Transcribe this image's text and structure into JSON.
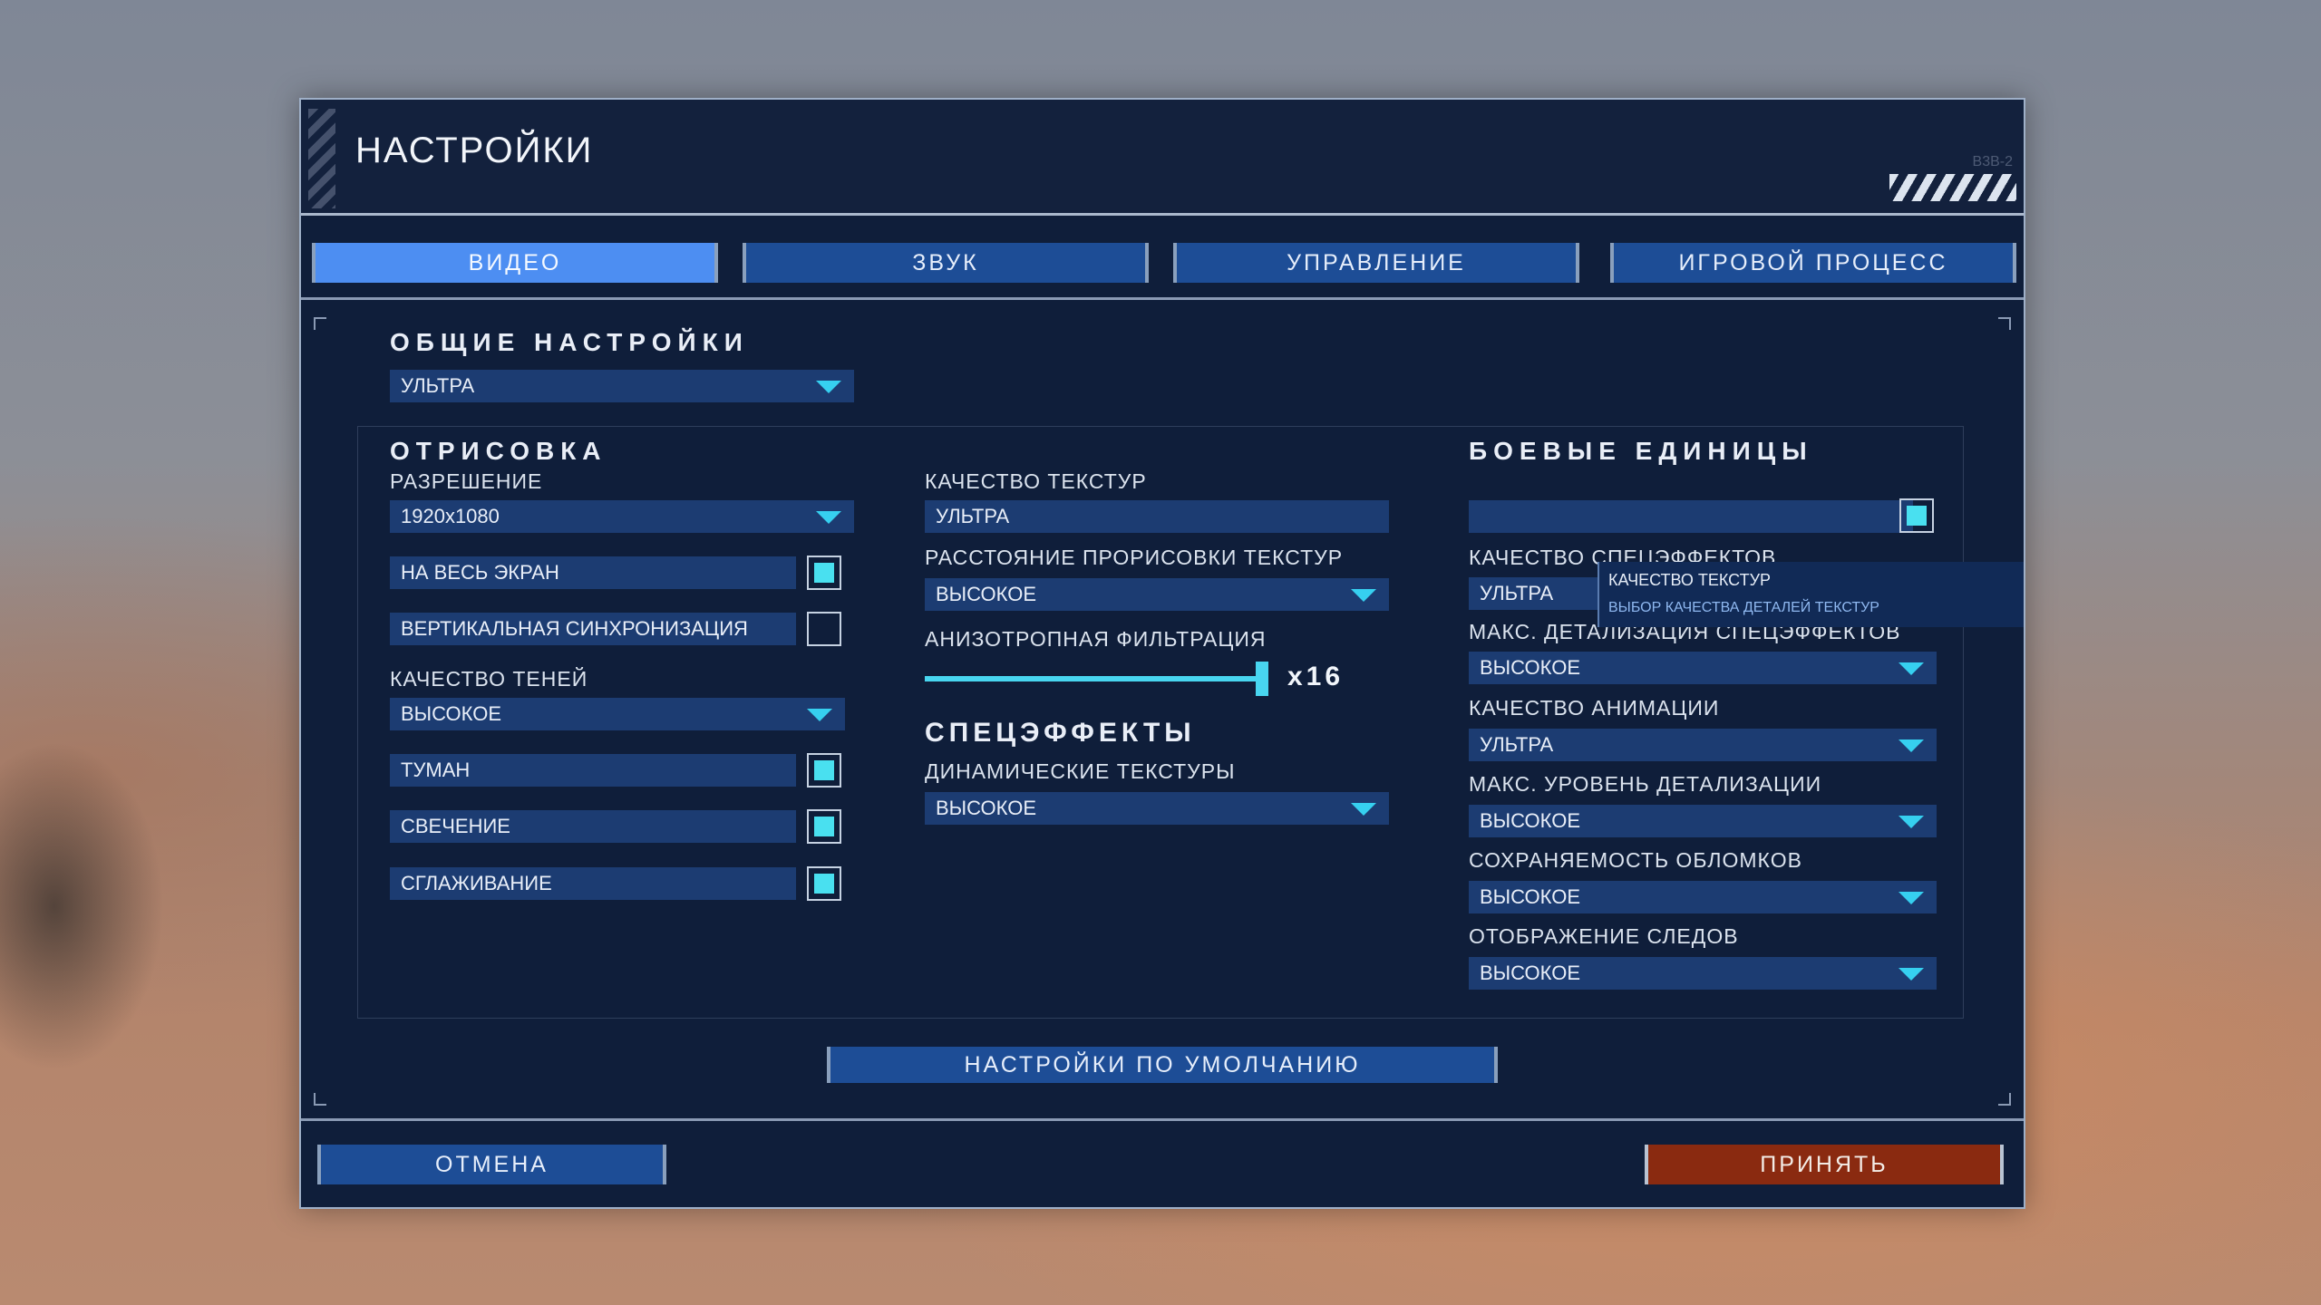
{
  "window": {
    "title": "НАСТРОЙКИ",
    "header_code": "B3B-2"
  },
  "tabs": [
    {
      "label": "ВИДЕО",
      "active": true
    },
    {
      "label": "ЗВУК",
      "active": false
    },
    {
      "label": "УПРАВЛЕНИЕ",
      "active": false
    },
    {
      "label": "ИГРОВОЙ ПРОЦЕСС",
      "active": false
    }
  ],
  "general": {
    "title": "ОБЩИЕ НАСТРОЙКИ",
    "preset": "УЛЬТРА"
  },
  "rendering": {
    "title": "ОТРИСОВКА",
    "resolution_label": "РАЗРЕШЕНИЕ",
    "resolution_value": "1920x1080",
    "fullscreen_label": "НА ВЕСЬ ЭКРАН",
    "fullscreen_checked": true,
    "vsync_label": "ВЕРТИКАЛЬНАЯ СИНХРОНИЗАЦИЯ",
    "vsync_checked": false,
    "shadows_label": "КАЧЕСТВО ТЕНЕЙ",
    "shadows_value": "ВЫСОКОЕ",
    "fog_label": "ТУМАН",
    "fog_checked": true,
    "glow_label": "СВЕЧЕНИЕ",
    "glow_checked": true,
    "aa_label": "СГЛАЖИВАНИЕ",
    "aa_checked": true
  },
  "textures": {
    "quality_label": "КАЧЕСТВО ТЕКСТУР",
    "quality_value": "УЛЬТРА",
    "distance_label": "РАССТОЯНИЕ ПРОРИСОВКИ ТЕКСТУР",
    "distance_value": "ВЫСОКОЕ",
    "aniso_label": "АНИЗОТРОПНАЯ ФИЛЬТРАЦИЯ",
    "aniso_value_text": "x16",
    "aniso_fraction": 1.0
  },
  "effects": {
    "title": "СПЕЦЭФФЕКТЫ",
    "dynamic_label": "ДИНАМИЧЕСКИЕ ТЕКСТУРЫ",
    "dynamic_value": "ВЫСОКОЕ"
  },
  "units": {
    "title": "БОЕВЫЕ ЕДИНИЦЫ",
    "top_checkbox_checked": true,
    "fx_quality_label": "КАЧЕСТВО СПЕЦЭФФЕКТОВ",
    "fx_quality_value": "УЛЬТРА",
    "fx_detail_label": "МАКС. ДЕТАЛИЗАЦИЯ СПЕЦЭФФЕКТОВ",
    "fx_detail_value": "ВЫСОКОЕ",
    "anim_label": "КАЧЕСТВО АНИМАЦИИ",
    "anim_value": "УЛЬТРА",
    "lod_label": "МАКС. УРОВЕНЬ ДЕТАЛИЗАЦИИ",
    "lod_value": "ВЫСОКОЕ",
    "debris_label": "СОХРАНЯЕМОСТЬ ОБЛОМКОВ",
    "debris_value": "ВЫСОКОЕ",
    "tracks_label": "ОТОБРАЖЕНИЕ СЛЕДОВ",
    "tracks_value": "ВЫСОКОЕ"
  },
  "tooltip": {
    "title": "КАЧЕСТВО ТЕКСТУР",
    "description": "ВЫБОР КАЧЕСТВА ДЕТАЛЕЙ ТЕКСТУР"
  },
  "buttons": {
    "defaults": "НАСТРОЙКИ ПО УМОЛЧАНИЮ",
    "cancel": "ОТМЕНА",
    "accept": "ПРИНЯТЬ"
  },
  "colors": {
    "accent": "#49e0f0",
    "tab_active": "#4d8ef2",
    "tab_inactive": "#1d4d96",
    "accept": "#8a2a10",
    "panel_bg": "#0f1e3a"
  }
}
